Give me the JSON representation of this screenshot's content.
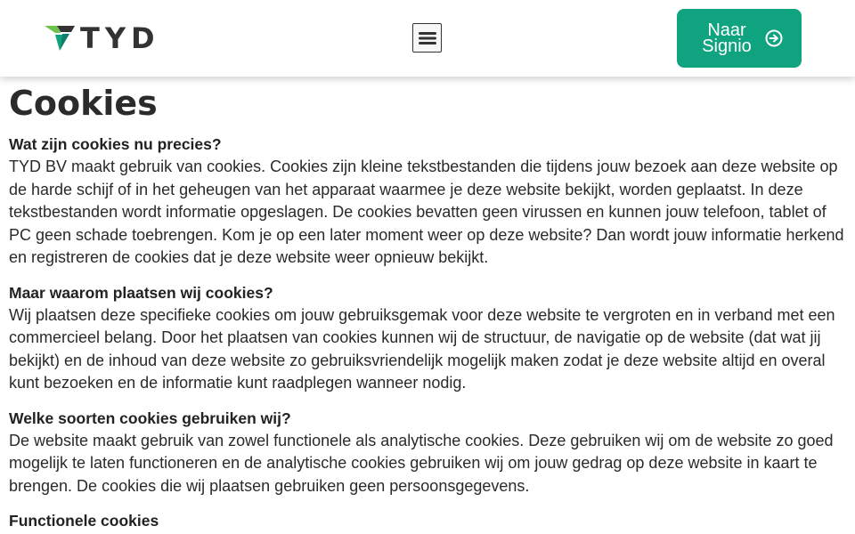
{
  "header": {
    "logo_text": "TYD",
    "menu_icon": "hamburger-menu-icon",
    "cta_label": "Naar\nSignio",
    "cta_icon": "arrow-circle-right-icon",
    "colors": {
      "cta_bg": "#10a37f",
      "logo_green": "#6cc24a",
      "logo_teal": "#10a37f",
      "logo_dark": "#333333"
    }
  },
  "page": {
    "title": "Cookies",
    "sections": [
      {
        "title": "Wat zijn cookies nu precies?",
        "body": "TYD BV maakt gebruik van cookies. Cookies zijn kleine tekstbestanden die tijdens jouw bezoek aan deze website op de harde schijf of in het geheugen van het apparaat waarmee je deze website bekijkt, worden geplaatst. In deze tekstbestanden wordt informatie opgeslagen. De cookies bevatten geen virussen en kunnen jouw telefoon, tablet of PC geen schade toebrengen. Kom je op een later moment weer op deze website? Dan wordt jouw informatie herkend en registreren de cookies dat je deze website weer opnieuw bekijkt."
      },
      {
        "title": "Maar waarom plaatsen wij cookies?",
        "body": "Wij plaatsen deze specifieke cookies om jouw gebruiksgemak voor deze website te vergroten en in verband met een commercieel belang. Door het plaatsen van cookies kunnen wij de structuur, de navigatie op de website (dat wat jij bekijkt) en de inhoud van deze website zo gebruiksvriendelijk mogelijk maken zodat je deze website altijd en overal kunt bezoeken en de informatie kunt raadplegen wanneer nodig."
      },
      {
        "title": "Welke soorten cookies gebruiken wij?",
        "body": "De website maakt gebruik van zowel functionele als analytische cookies. Deze gebruiken wij om de website zo goed mogelijk te laten functioneren en de analytische cookies gebruiken wij om jouw gedrag op deze website in kaart te brengen. De cookies die wij plaatsen gebruiken geen persoonsgegevens."
      },
      {
        "title": "Functionele cookies",
        "body": ""
      }
    ]
  }
}
